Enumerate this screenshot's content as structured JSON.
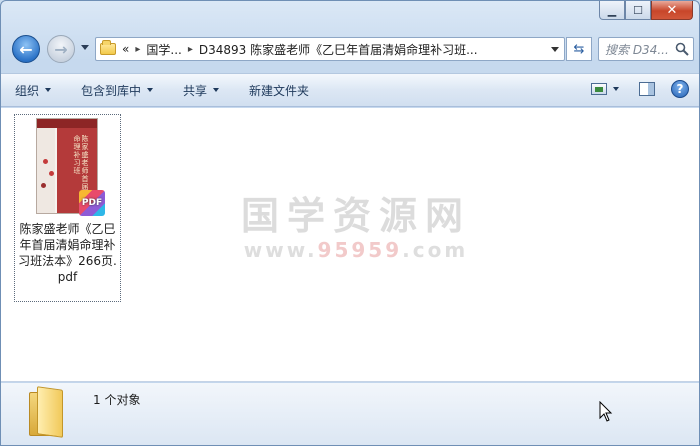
{
  "nav": {
    "back_icon": "back-arrow-icon",
    "forward_icon": "forward-arrow-icon"
  },
  "address": {
    "overflow": "«",
    "crumbs": [
      "国学...",
      "D34893 陈家盛老师《乙巳年首届清娟命理补习班..."
    ],
    "separator": "▸"
  },
  "search": {
    "placeholder": "搜索 D34..."
  },
  "toolbar": {
    "organize": "组织",
    "include_library": "包含到库中",
    "share": "共享",
    "new_folder": "新建文件夹"
  },
  "file": {
    "name": "陈家盛老师《乙巳年首届清娟命理补习班法本》266页.pdf",
    "badge": "PDF",
    "cover_text": "陈家盛老师首届清娟命理补习班"
  },
  "watermark": {
    "text": "国学资源网",
    "url_prefix": "www.",
    "url_number": "95959",
    "url_suffix": ".com"
  },
  "details": {
    "count": "1 个对象"
  },
  "colors": {
    "accent": "#2d74c8",
    "close": "#c8462a",
    "cover_red": "#b43a3a"
  }
}
